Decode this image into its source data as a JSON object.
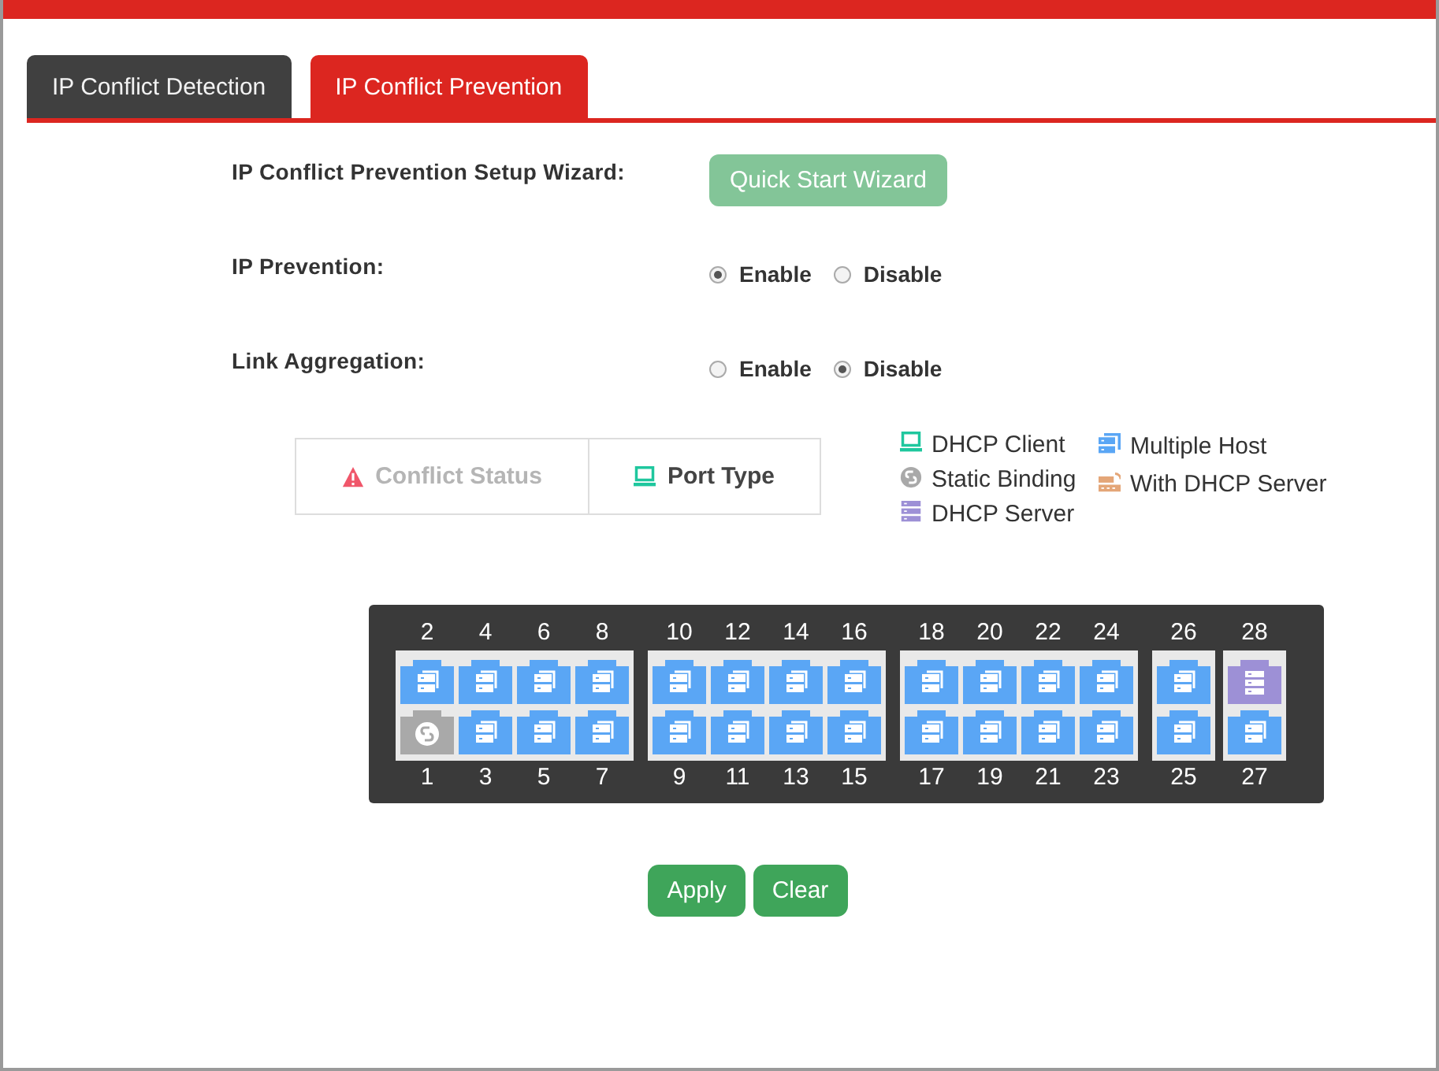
{
  "tabs": [
    {
      "label": "IP Conflict Detection",
      "selected": false
    },
    {
      "label": "IP Conflict Prevention",
      "selected": true
    }
  ],
  "settings": [
    {
      "kind": "button",
      "label": "IP Conflict Prevention Setup Wizard:",
      "button": "Quick Start Wizard"
    },
    {
      "kind": "radio",
      "label": "IP Prevention:",
      "options": [
        {
          "label": "Enable",
          "selected": true
        },
        {
          "label": "Disable",
          "selected": false
        }
      ]
    },
    {
      "kind": "radio",
      "label": "Link Aggregation:",
      "options": [
        {
          "label": "Enable",
          "selected": false
        },
        {
          "label": "Disable",
          "selected": true
        }
      ]
    }
  ],
  "view_toggle": [
    {
      "label": "Conflict Status",
      "kind": "warning",
      "selected": false
    },
    {
      "label": "Port Type",
      "kind": "dhcp_client",
      "selected": true
    }
  ],
  "legend": {
    "columns": [
      [
        {
          "kind": "dhcp_client",
          "label": "DHCP Client"
        },
        {
          "kind": "static_binding",
          "label": "Static Binding"
        },
        {
          "kind": "dhcp_server",
          "label": "DHCP Server"
        }
      ],
      [
        {
          "kind": "multiple_host",
          "label": "Multiple Host"
        },
        {
          "kind": "with_dhcp_server",
          "label": "With DHCP Server"
        }
      ]
    ]
  },
  "port_groups": [
    {
      "columns": [
        {
          "top": {
            "number": "2",
            "kind": "multiple_host"
          },
          "bottom": {
            "number": "1",
            "kind": "static_binding"
          }
        },
        {
          "top": {
            "number": "4",
            "kind": "multiple_host"
          },
          "bottom": {
            "number": "3",
            "kind": "multiple_host"
          }
        },
        {
          "top": {
            "number": "6",
            "kind": "multiple_host"
          },
          "bottom": {
            "number": "5",
            "kind": "multiple_host"
          }
        },
        {
          "top": {
            "number": "8",
            "kind": "multiple_host"
          },
          "bottom": {
            "number": "7",
            "kind": "multiple_host"
          }
        }
      ]
    },
    {
      "columns": [
        {
          "top": {
            "number": "10",
            "kind": "multiple_host"
          },
          "bottom": {
            "number": "9",
            "kind": "multiple_host"
          }
        },
        {
          "top": {
            "number": "12",
            "kind": "multiple_host"
          },
          "bottom": {
            "number": "11",
            "kind": "multiple_host"
          }
        },
        {
          "top": {
            "number": "14",
            "kind": "multiple_host"
          },
          "bottom": {
            "number": "13",
            "kind": "multiple_host"
          }
        },
        {
          "top": {
            "number": "16",
            "kind": "multiple_host"
          },
          "bottom": {
            "number": "15",
            "kind": "multiple_host"
          }
        }
      ]
    },
    {
      "columns": [
        {
          "top": {
            "number": "18",
            "kind": "multiple_host"
          },
          "bottom": {
            "number": "17",
            "kind": "multiple_host"
          }
        },
        {
          "top": {
            "number": "20",
            "kind": "multiple_host"
          },
          "bottom": {
            "number": "19",
            "kind": "multiple_host"
          }
        },
        {
          "top": {
            "number": "22",
            "kind": "multiple_host"
          },
          "bottom": {
            "number": "21",
            "kind": "multiple_host"
          }
        },
        {
          "top": {
            "number": "24",
            "kind": "multiple_host"
          },
          "bottom": {
            "number": "23",
            "kind": "multiple_host"
          }
        }
      ]
    },
    {
      "columns": [
        {
          "top": {
            "number": "26",
            "kind": "multiple_host"
          },
          "bottom": {
            "number": "25",
            "kind": "multiple_host"
          }
        }
      ]
    },
    {
      "columns": [
        {
          "top": {
            "number": "28",
            "kind": "dhcp_server"
          },
          "bottom": {
            "number": "27",
            "kind": "multiple_host"
          }
        }
      ]
    }
  ],
  "buttons": [
    {
      "label": "Apply"
    },
    {
      "label": "Clear"
    }
  ]
}
